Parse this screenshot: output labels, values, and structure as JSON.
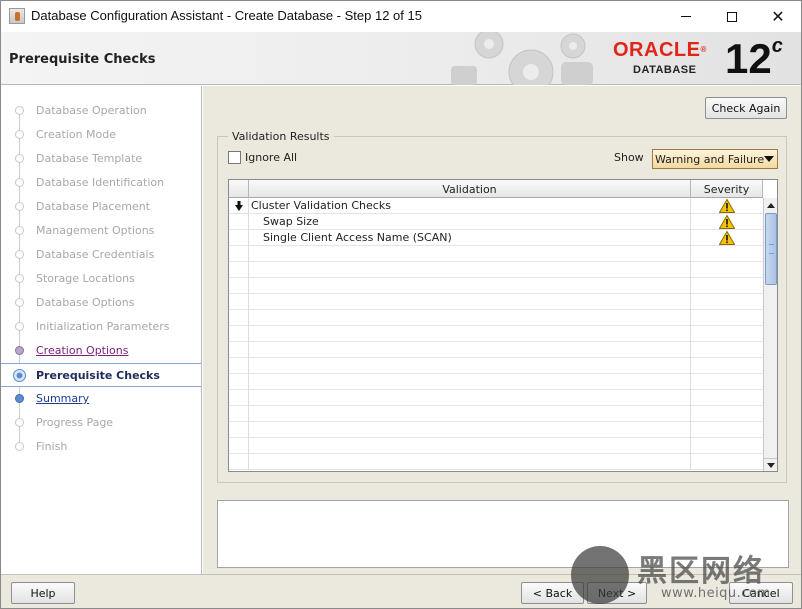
{
  "window": {
    "title": "Database Configuration Assistant - Create Database - Step 12 of 15",
    "minimize_glyph": "",
    "maximize_glyph": "",
    "close_glyph": "✕"
  },
  "header": {
    "page_title": "Prerequisite Checks",
    "logo_brand": "ORACLE",
    "logo_registered": "®",
    "logo_product": "DATABASE",
    "logo_version": "12",
    "logo_version_suffix": "c"
  },
  "nav": {
    "items": [
      {
        "label": "Database Operation",
        "state": "done"
      },
      {
        "label": "Creation Mode",
        "state": "done"
      },
      {
        "label": "Database Template",
        "state": "done"
      },
      {
        "label": "Database Identification",
        "state": "done"
      },
      {
        "label": "Database Placement",
        "state": "done"
      },
      {
        "label": "Management Options",
        "state": "done"
      },
      {
        "label": "Database Credentials",
        "state": "done"
      },
      {
        "label": "Storage Locations",
        "state": "done"
      },
      {
        "label": "Database Options",
        "state": "done"
      },
      {
        "label": "Initialization Parameters",
        "state": "done"
      },
      {
        "label": "Creation Options",
        "state": "visited"
      },
      {
        "label": "Prerequisite Checks",
        "state": "current"
      },
      {
        "label": "Summary",
        "state": "next"
      },
      {
        "label": "Progress Page",
        "state": "disabled"
      },
      {
        "label": "Finish",
        "state": "disabled"
      }
    ]
  },
  "main": {
    "check_again_button": "Check Again",
    "group_title": "Validation Results",
    "ignore_all_label": "Ignore All",
    "ignore_all_checked": false,
    "show_label": "Show",
    "show_select_value": "Warning and Failure",
    "table": {
      "columns": [
        "",
        "Validation",
        "Severity"
      ],
      "rows": [
        {
          "expander": true,
          "validation": "Cluster Validation Checks",
          "severity": "warning"
        },
        {
          "expander": false,
          "validation": "Swap Size",
          "severity": "warning"
        },
        {
          "expander": false,
          "validation": "Single Client Access Name (SCAN)",
          "severity": "warning"
        }
      ]
    }
  },
  "footer": {
    "help_button": "Help",
    "back_button": "< Back",
    "next_button": "Next >",
    "cancel_button": "Cancel"
  },
  "watermark": {
    "text": "黑区网络",
    "url": "www.heiqu.com"
  },
  "colors": {
    "oracle_red": "#e0261b",
    "visited_link": "#7a1f7a",
    "next_link": "#1f3c94",
    "warning_yellow": "#f4c20d"
  }
}
